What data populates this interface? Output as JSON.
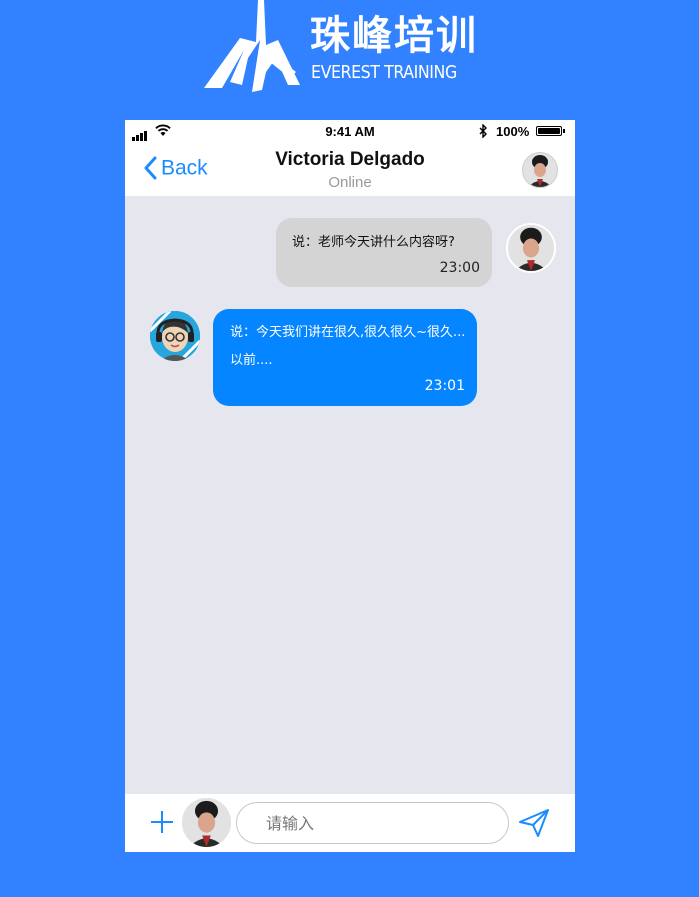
{
  "brand": {
    "name_cn": "珠峰培训",
    "name_en": "EVEREST TRAINING"
  },
  "status_bar": {
    "time": "9:41 AM",
    "battery": "100%",
    "bluetooth_icon": "bluetooth-icon",
    "wifi_icon": "wifi-icon",
    "signal_icon": "signal-icon"
  },
  "nav": {
    "back_label": "Back",
    "contact_name": "Victoria Delgado",
    "contact_status": "Online"
  },
  "messages": [
    {
      "direction": "outgoing",
      "text": "说：老师今天讲什么内容呀?",
      "time": "23:00"
    },
    {
      "direction": "incoming",
      "text": "说：今天我们讲在很久,很久很久~很久...以前....",
      "time": "23:01"
    }
  ],
  "composer": {
    "placeholder": "请输入",
    "value": "",
    "add_icon": "plus-icon",
    "send_icon": "send-icon"
  },
  "colors": {
    "page_background": "#3282ff",
    "chat_background": "#e6e6ef",
    "accent": "#1a8cff",
    "incoming_bubble": "#0585ff",
    "outgoing_bubble": "#d4d4d4"
  }
}
